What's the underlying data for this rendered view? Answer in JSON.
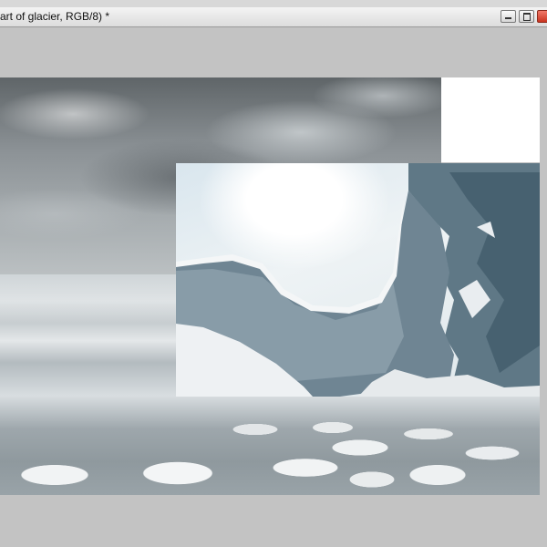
{
  "window": {
    "title": "art of glacier, RGB/8) *",
    "controls": {
      "minimize_icon": "minimize-icon",
      "restore_icon": "restore-icon",
      "close_icon": "close-icon"
    }
  },
  "colors": {
    "workspace": "#c3c3c3",
    "titlebar": "#e6e6e6",
    "close_button": "#d9412d"
  },
  "canvas": {
    "layers": [
      "stormy-sky-photo",
      "white-rectangle",
      "glacier-ice-cave-photo",
      "ice-floes-photo"
    ]
  }
}
